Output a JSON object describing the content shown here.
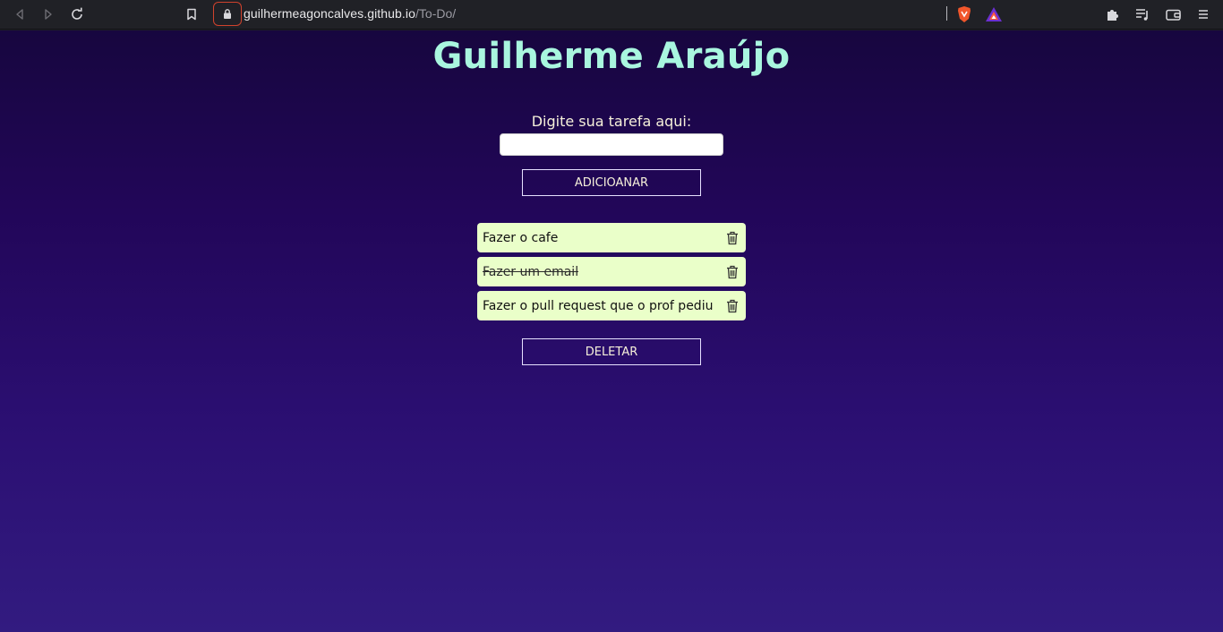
{
  "browser": {
    "url_host": "guilhermeagoncalves.github.io",
    "url_path": "/To-Do/",
    "icons": [
      "back-icon",
      "forward-icon",
      "reload-icon",
      "bookmark-icon",
      "lock-icon",
      "brave-shields-icon",
      "brave-rewards-icon",
      "extensions-icon",
      "playlist-icon",
      "wallet-icon",
      "menu-icon"
    ]
  },
  "page": {
    "title": "Guilherme Araújo",
    "input_label": "Digite sua tarefa aqui:",
    "input_value": "",
    "add_button": "ADICIOANAR",
    "delete_button": "DELETAR",
    "tasks": [
      {
        "text": "Fazer o cafe",
        "done": false
      },
      {
        "text": "Fazer um email",
        "done": true
      },
      {
        "text": "Fazer o pull request que o prof pediu",
        "done": false
      }
    ]
  },
  "colors": {
    "title": "#a9f6df",
    "task_bg": "#eaffc9",
    "background_top": "#17063f",
    "background_bottom": "#321b80",
    "lock_highlight": "#d0422d"
  }
}
